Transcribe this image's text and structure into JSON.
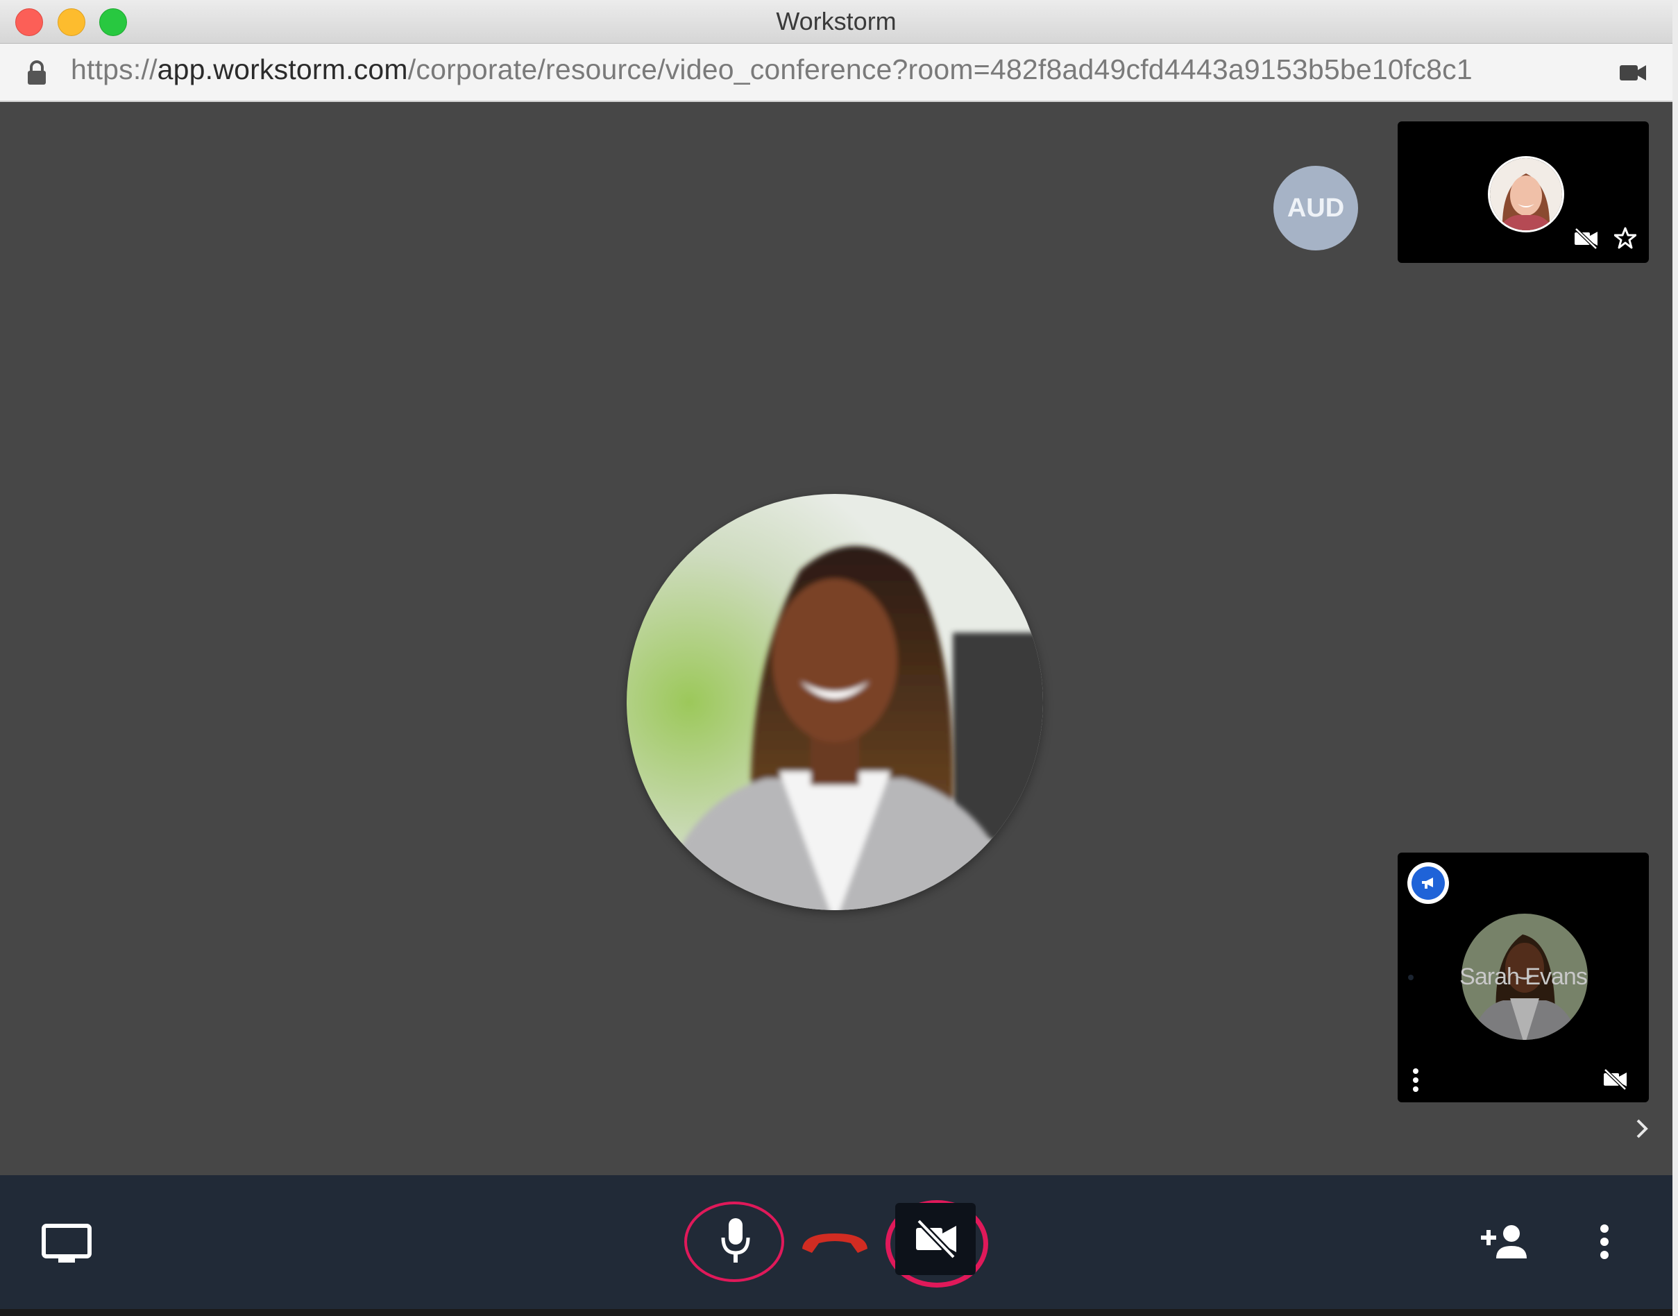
{
  "window": {
    "title": "Workstorm"
  },
  "addressbar": {
    "scheme": "https://",
    "host": "app.workstorm.com",
    "path": "/corporate/resource/video_conference?room=482f8ad49cfd4443a9153b5be10fc8c1"
  },
  "stage": {
    "audience_badge": "AUD",
    "participants": [
      {
        "name": "Sarah Evans",
        "video": "off"
      }
    ]
  },
  "toolbar": {
    "icons": [
      "screen-share-icon",
      "microphone-icon",
      "hang-up-icon",
      "video-off-icon",
      "add-person-icon",
      "more-options-icon"
    ]
  },
  "colors": {
    "stage_bg": "#474747",
    "toolbar_bg": "#212a37",
    "highlight_ring": "#e0195a",
    "hangup_red": "#d12c22",
    "audience_badge": "#a6b3c6",
    "presenter_badge": "#1f63d8"
  }
}
